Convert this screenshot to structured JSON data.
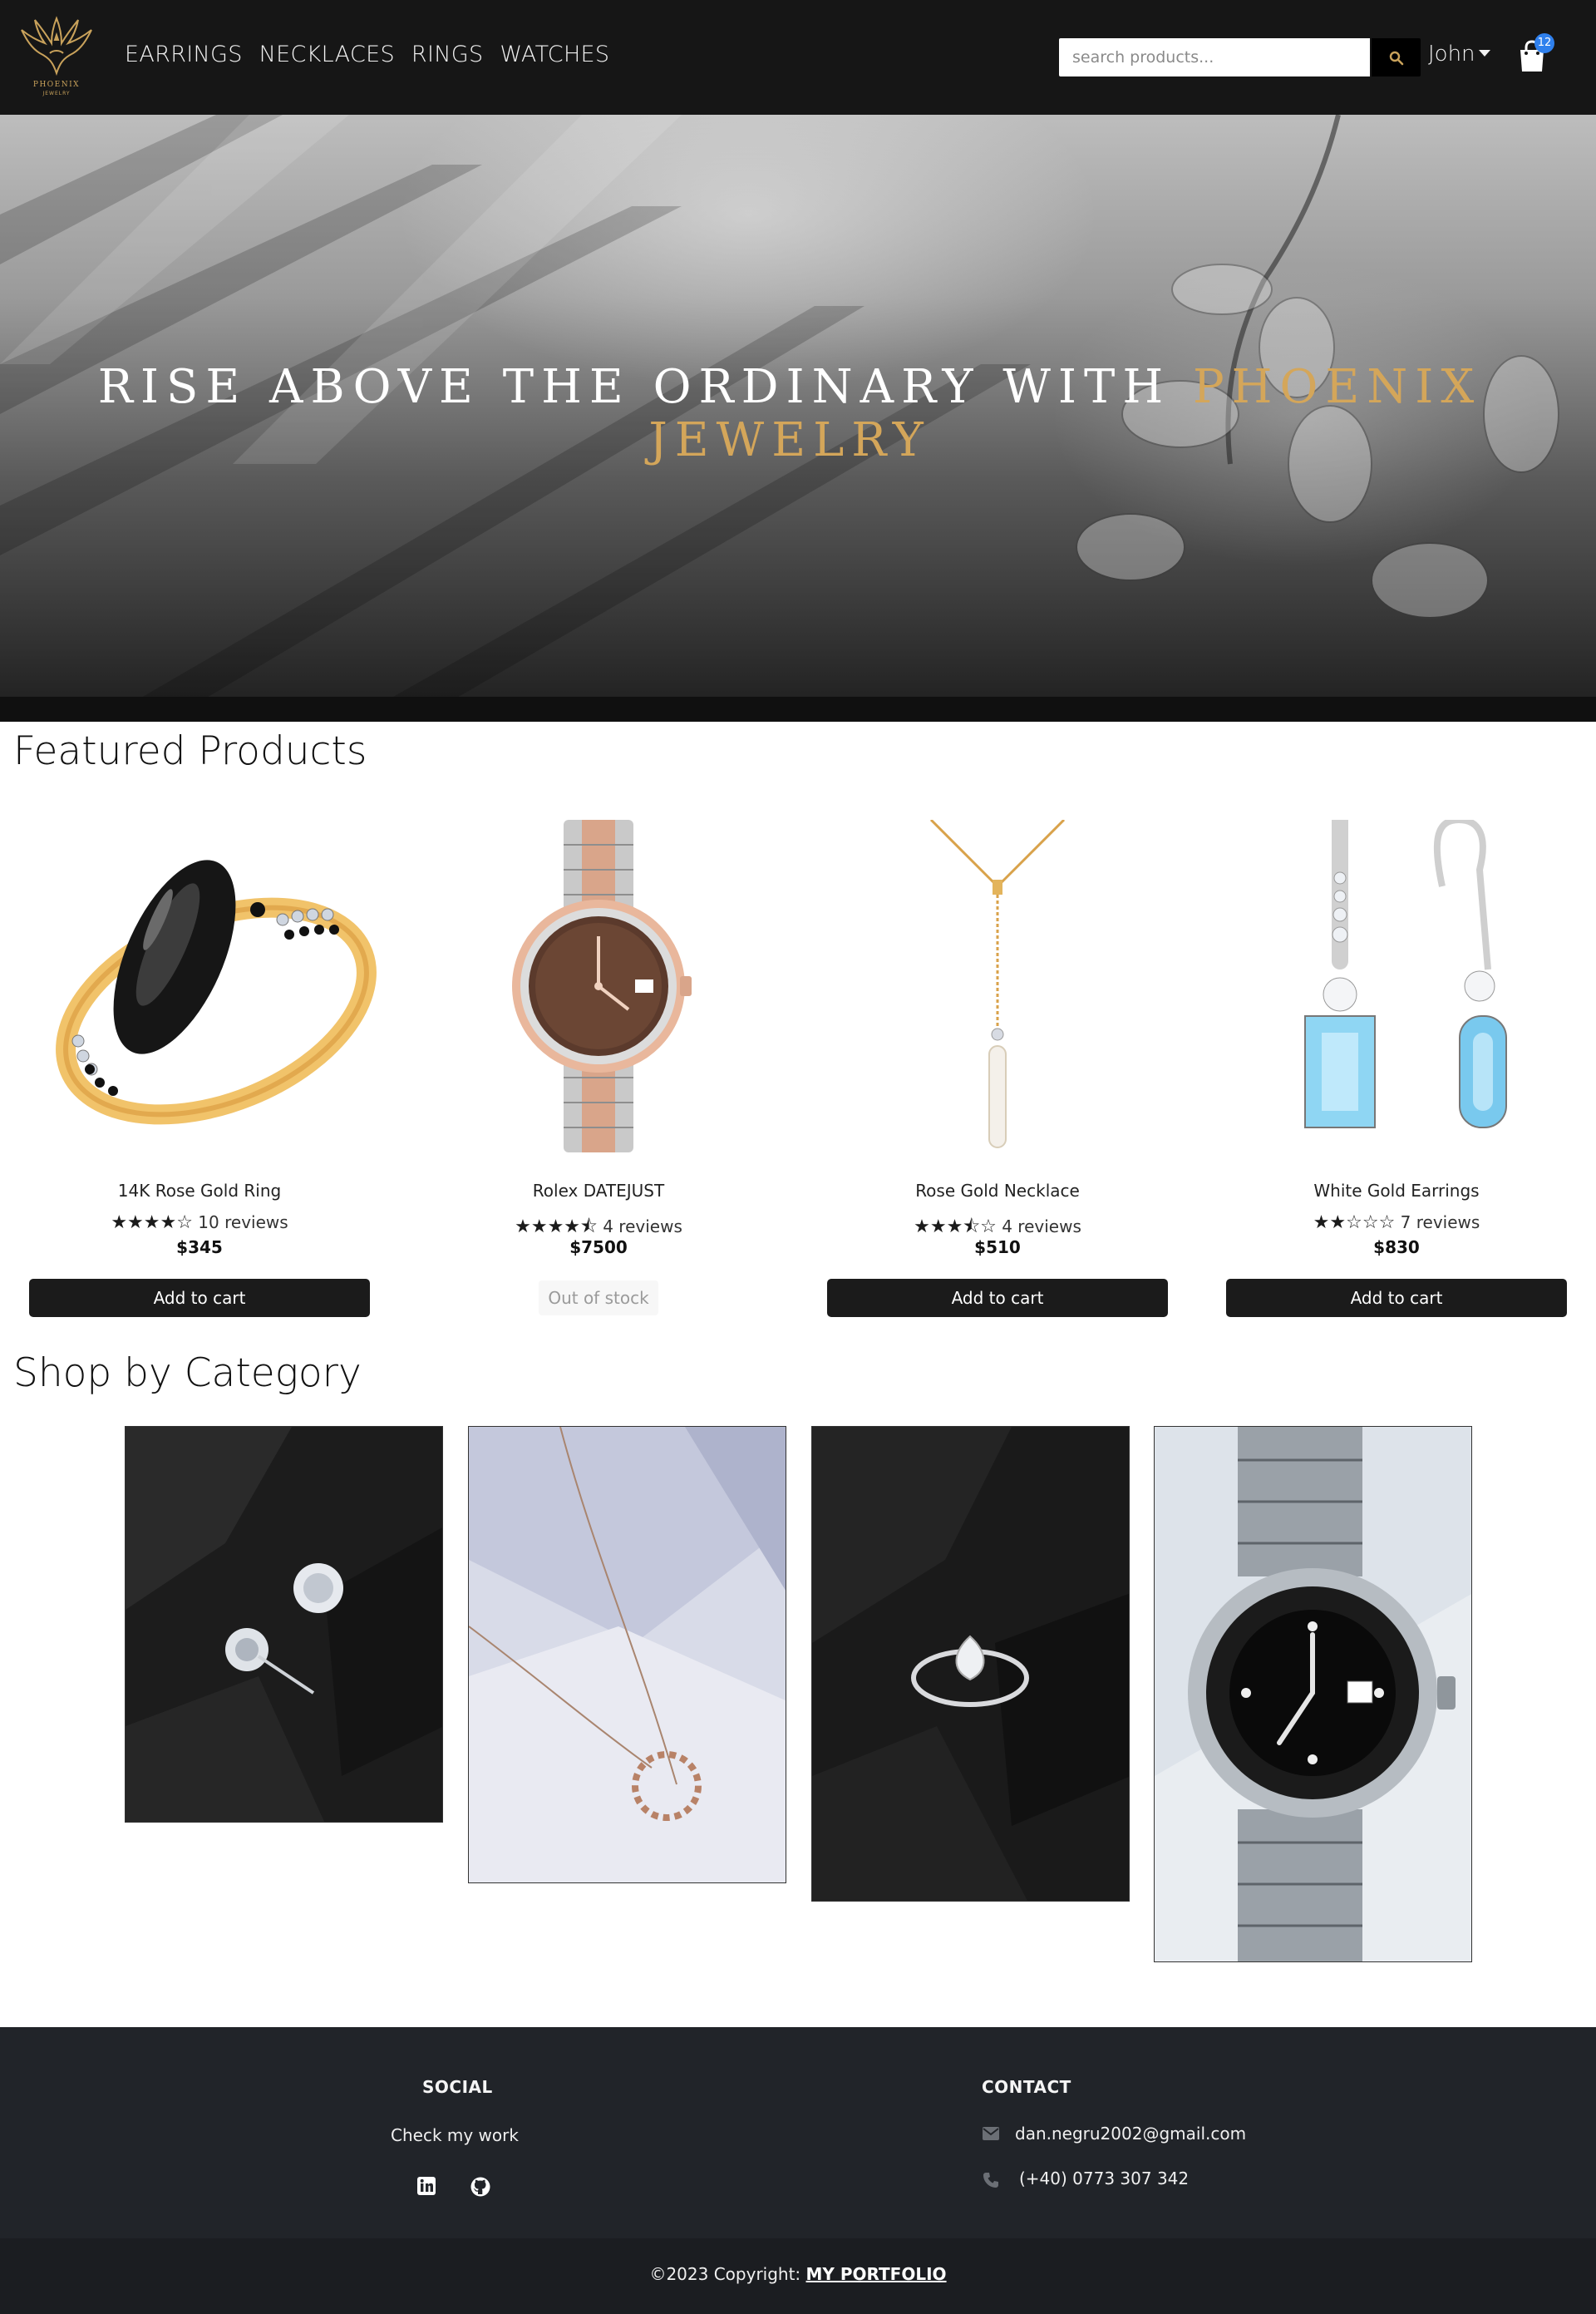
{
  "brand": {
    "logo_text": "PHOENIX",
    "logo_sub": "JEWELRY"
  },
  "nav": {
    "links": [
      "EARRINGS",
      "NECKLACES",
      "RINGS",
      "WATCHES"
    ],
    "search_placeholder": "search products...",
    "user_name": "John",
    "cart_count": "12"
  },
  "hero": {
    "title_part1": "RISE ABOVE THE ORDINARY WITH ",
    "title_part2": "PHOENIX JEWELRY"
  },
  "featured": {
    "title": "Featured Products",
    "products": [
      {
        "name": "14K Rose Gold Ring",
        "rating": 4,
        "stars": "★★★★☆",
        "reviews": "10 reviews",
        "price": "$345",
        "action": "Add to cart",
        "in_stock": true
      },
      {
        "name": "Rolex DATEJUST",
        "rating": 4.5,
        "stars": "★★★★⯪",
        "reviews": "4 reviews",
        "price": "$7500",
        "action": "Out of stock",
        "in_stock": false
      },
      {
        "name": "Rose Gold Necklace",
        "rating": 3.5,
        "stars": "★★★⯪☆",
        "reviews": "4 reviews",
        "price": "$510",
        "action": "Add to cart",
        "in_stock": true
      },
      {
        "name": "White Gold Earrings",
        "rating": 2,
        "stars": "★★☆☆☆",
        "reviews": "7 reviews",
        "price": "$830",
        "action": "Add to cart",
        "in_stock": true
      }
    ]
  },
  "categories": {
    "title": "Shop by Category"
  },
  "footer": {
    "social_title": "SOCIAL",
    "social_text": "Check my work",
    "contact_title": "CONTACT",
    "email": "dan.negru2002@gmail.com",
    "phone": "(+40) 0773 307 342",
    "copyright": "©2023 Copyright: ",
    "portfolio_link": "MY PORTFOLIO"
  },
  "colors": {
    "navbar": "#161616",
    "accent_gold": "#d4a65a",
    "button": "#1b1b1b",
    "footer": "#212429",
    "badge": "#2f80ed"
  }
}
